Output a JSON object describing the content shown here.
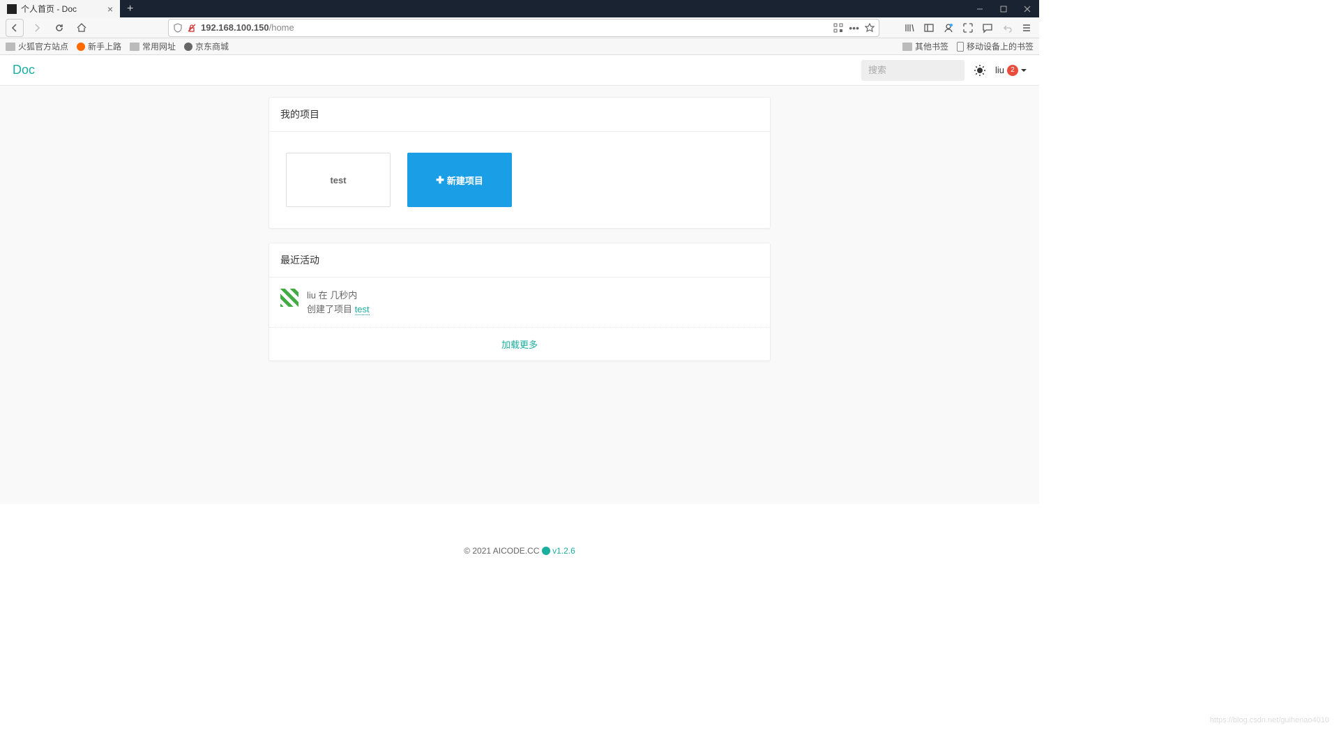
{
  "browser": {
    "tab_title": "个人首页 - Doc",
    "url": "192.168.100.150",
    "url_path": "/home",
    "bookmarks": {
      "left": [
        {
          "label": "火狐官方站点",
          "type": "folder"
        },
        {
          "label": "新手上路",
          "type": "ball",
          "color": "#ff6a00"
        },
        {
          "label": "常用网址",
          "type": "folder"
        },
        {
          "label": "京东商城",
          "type": "ball",
          "color": "#666"
        }
      ],
      "right": [
        {
          "label": "其他书签",
          "type": "folder"
        },
        {
          "label": "移动设备上的书签",
          "type": "mobile"
        }
      ]
    }
  },
  "header": {
    "logo": "Doc",
    "search_placeholder": "搜索",
    "user_name": "liu",
    "badge_count": "2"
  },
  "main": {
    "projects": {
      "title": "我的项目",
      "items": [
        {
          "name": "test"
        }
      ],
      "new_label": "新建项目"
    },
    "activity": {
      "title": "最近活动",
      "items": [
        {
          "user": "liu",
          "time": "在 几秒内",
          "action_prefix": "创建了项目 ",
          "link": "test"
        }
      ],
      "load_more": "加载更多"
    }
  },
  "footer": {
    "copyright": "© 2021 AICODE.CC",
    "version": "v1.2.6"
  },
  "watermark": "https://blog.csdn.net/guihenao4010"
}
